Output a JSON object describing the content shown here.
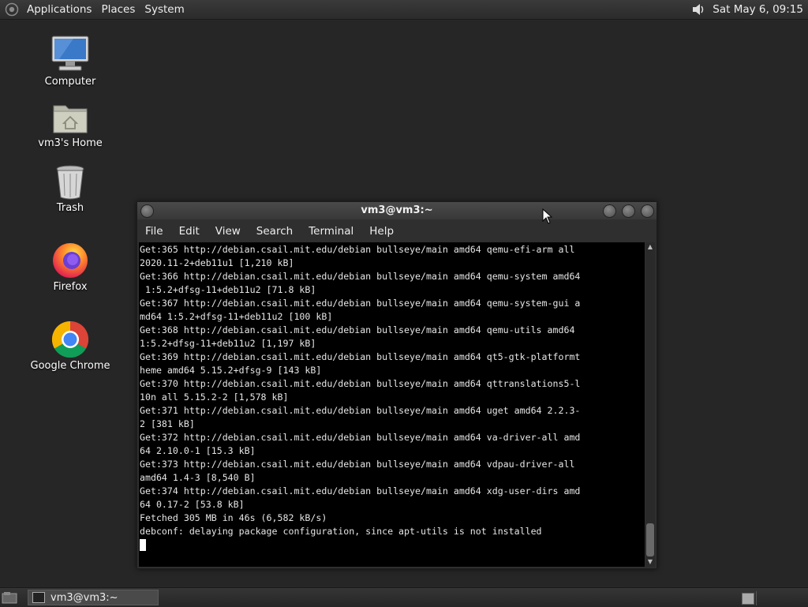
{
  "top_panel": {
    "menus": [
      "Applications",
      "Places",
      "System"
    ],
    "clock": "Sat May  6, 09:15"
  },
  "desktop_icons": [
    {
      "label": "Computer",
      "icon": "computer-icon"
    },
    {
      "label": "vm3's Home",
      "icon": "home-folder-icon"
    },
    {
      "label": "Trash",
      "icon": "trash-icon"
    },
    {
      "label": "Firefox",
      "icon": "firefox-icon"
    },
    {
      "label": "Google Chrome",
      "icon": "chrome-icon"
    }
  ],
  "window": {
    "title": "vm3@vm3:~",
    "menus": [
      "File",
      "Edit",
      "View",
      "Search",
      "Terminal",
      "Help"
    ],
    "terminal_lines": [
      "Get:365 http://debian.csail.mit.edu/debian bullseye/main amd64 qemu-efi-arm all",
      "2020.11-2+deb11u1 [1,210 kB]",
      "Get:366 http://debian.csail.mit.edu/debian bullseye/main amd64 qemu-system amd64",
      " 1:5.2+dfsg-11+deb11u2 [71.8 kB]",
      "Get:367 http://debian.csail.mit.edu/debian bullseye/main amd64 qemu-system-gui a",
      "md64 1:5.2+dfsg-11+deb11u2 [100 kB]",
      "Get:368 http://debian.csail.mit.edu/debian bullseye/main amd64 qemu-utils amd64",
      "1:5.2+dfsg-11+deb11u2 [1,197 kB]",
      "Get:369 http://debian.csail.mit.edu/debian bullseye/main amd64 qt5-gtk-platformt",
      "heme amd64 5.15.2+dfsg-9 [143 kB]",
      "Get:370 http://debian.csail.mit.edu/debian bullseye/main amd64 qttranslations5-l",
      "10n all 5.15.2-2 [1,578 kB]",
      "Get:371 http://debian.csail.mit.edu/debian bullseye/main amd64 uget amd64 2.2.3-",
      "2 [381 kB]",
      "Get:372 http://debian.csail.mit.edu/debian bullseye/main amd64 va-driver-all amd",
      "64 2.10.0-1 [15.3 kB]",
      "Get:373 http://debian.csail.mit.edu/debian bullseye/main amd64 vdpau-driver-all",
      "amd64 1.4-3 [8,540 B]",
      "Get:374 http://debian.csail.mit.edu/debian bullseye/main amd64 xdg-user-dirs amd",
      "64 0.17-2 [53.8 kB]",
      "Fetched 305 MB in 46s (6,582 kB/s)",
      "debconf: delaying package configuration, since apt-utils is not installed"
    ]
  },
  "taskbar": {
    "task_label": "vm3@vm3:~"
  }
}
